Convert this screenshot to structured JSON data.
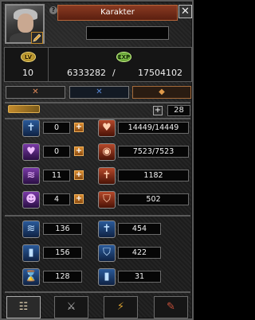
{
  "window": {
    "title": "Karakter",
    "close": "✕",
    "info": "?"
  },
  "portrait": {
    "edit_icon": "pencil-icon"
  },
  "name_field": "",
  "level": {
    "badge": "LV",
    "value": "10"
  },
  "exp": {
    "badge": "EXP",
    "current": "6333282",
    "separator": "/",
    "max": "17504102"
  },
  "mode_buttons": [
    {
      "icon": "x-icon",
      "glyph": "✕"
    },
    {
      "icon": "blue-x-icon",
      "glyph": "✕"
    },
    {
      "icon": "ornament-icon",
      "glyph": "◆"
    }
  ],
  "points": {
    "plus": "+",
    "value": "28"
  },
  "left_stats": [
    {
      "icon": "sword-stat-icon",
      "glyph": "✝",
      "color": "blue",
      "value": "0",
      "plus": "+"
    },
    {
      "icon": "heart-stat-icon",
      "glyph": "♥",
      "color": "purple",
      "value": "0",
      "plus": "+"
    },
    {
      "icon": "wind-stat-icon",
      "glyph": "≋",
      "color": "purple",
      "value": "11",
      "plus": "+"
    },
    {
      "icon": "head-stat-icon",
      "glyph": "☻",
      "color": "purple",
      "value": "4",
      "plus": "+"
    }
  ],
  "right_stats": [
    {
      "icon": "hp-heart-icon",
      "glyph": "♥",
      "value": "14449/14449"
    },
    {
      "icon": "mp-orb-icon",
      "glyph": "◉",
      "value": "7523/7523"
    },
    {
      "icon": "attack-icon",
      "glyph": "✝",
      "value": "1182"
    },
    {
      "icon": "defense-shield-icon",
      "glyph": "⛉",
      "value": "502"
    }
  ],
  "lower_left": [
    {
      "icon": "speed-icon",
      "glyph": "≋",
      "value": "136"
    },
    {
      "icon": "magic-bar-icon",
      "glyph": "▮",
      "value": "156"
    },
    {
      "icon": "hourglass-icon",
      "glyph": "⌛",
      "value": "128"
    }
  ],
  "lower_right": [
    {
      "icon": "magic-attack-icon",
      "glyph": "✝",
      "value": "454"
    },
    {
      "icon": "magic-defense-icon",
      "glyph": "⛉",
      "value": "422"
    },
    {
      "icon": "pillar-icon",
      "glyph": "▮",
      "value": "31"
    }
  ],
  "bottom_tabs": [
    {
      "icon": "character-card-icon",
      "glyph": "☷"
    },
    {
      "icon": "sword-tab-icon",
      "glyph": "⚔"
    },
    {
      "icon": "skill-tab-icon",
      "glyph": "⚡"
    },
    {
      "icon": "blade-tab-icon",
      "glyph": "✎"
    }
  ]
}
